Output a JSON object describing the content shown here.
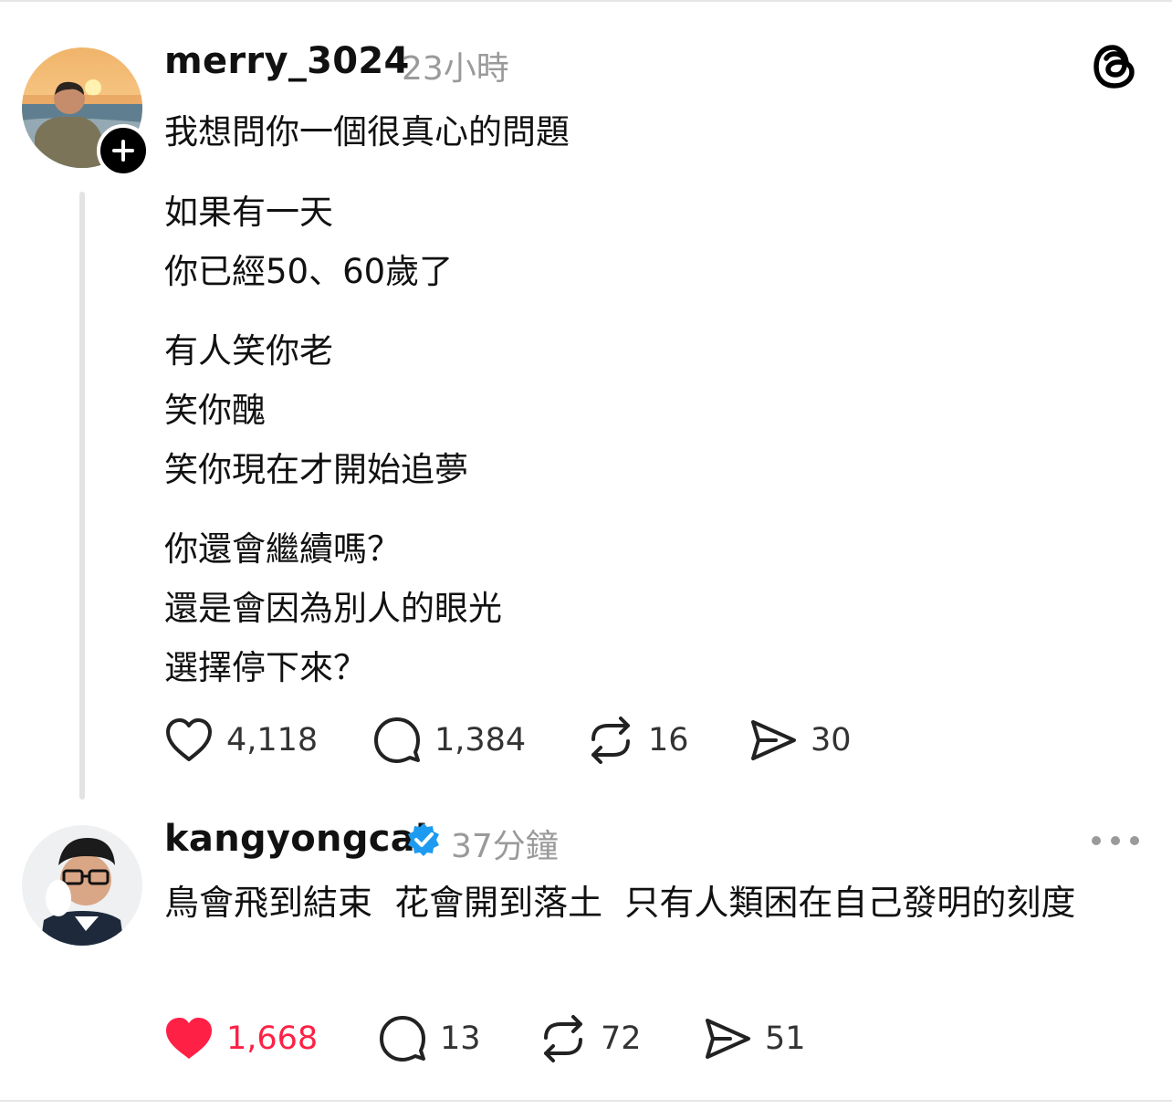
{
  "post": {
    "username": "merry_3024",
    "time": "23小時",
    "lines": [
      "我想問你一個很真心的問題",
      "如果有一天",
      "你已經50、60歲了",
      "有人笑你老",
      "笑你醜",
      "笑你現在才開始追夢",
      "你還會繼續嗎？",
      "還是會因為別人的眼光",
      "選擇停下來？"
    ],
    "likes": "4,118",
    "comments": "1,384",
    "reposts": "16",
    "shares": "30"
  },
  "reply": {
    "username": "kangyongcai",
    "time": "37分鐘",
    "text": "鳥會飛到結束  花會開到落土  只有人類困在自己發明的刻度",
    "likes": "1,668",
    "comments": "13",
    "reposts": "72",
    "shares": "51"
  },
  "icons": {
    "app_logo": "threads-logo-icon",
    "follow": "plus-icon",
    "verified": "verified-badge-icon",
    "more": "more-icon",
    "like": "heart-icon",
    "comment": "comment-bubble-icon",
    "repost": "repost-icon",
    "share": "send-icon"
  },
  "colors": {
    "liked": "#ff2046",
    "verified": "#1d9bf0",
    "muted": "#9a9a9a"
  }
}
